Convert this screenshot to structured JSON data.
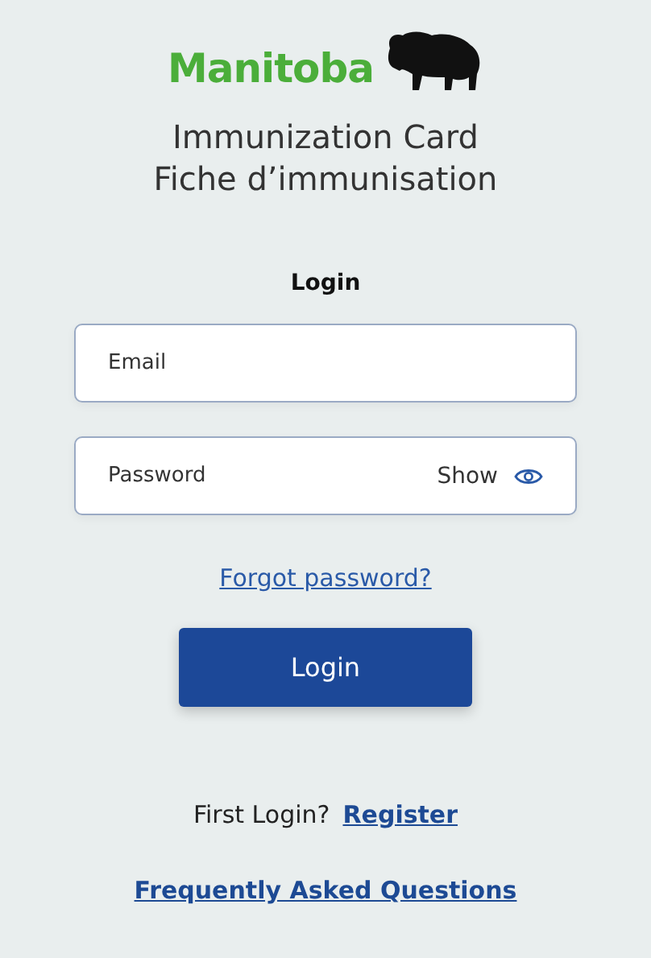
{
  "logo": {
    "wordmark": "Manitoba"
  },
  "title": [
    "Immunization Card",
    "Fiche d’immunisation"
  ],
  "form": {
    "heading": "Login",
    "email": {
      "placeholder": "Email"
    },
    "password": {
      "placeholder": "Password",
      "toggle": "Show"
    },
    "forgot": "Forgot password?",
    "submit": "Login"
  },
  "register": {
    "prompt": "First Login?",
    "link": "Register"
  },
  "faq": "Frequently Asked Questions"
}
